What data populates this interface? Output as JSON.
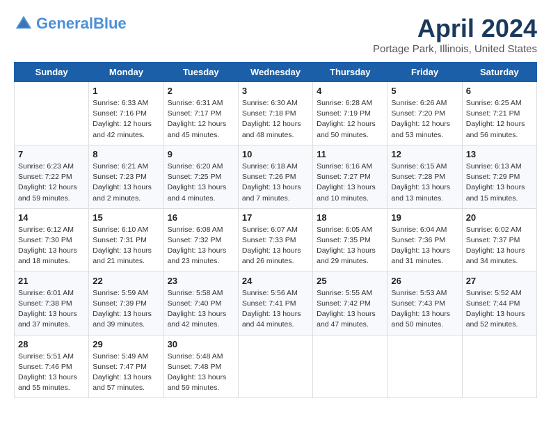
{
  "header": {
    "logo_line1": "General",
    "logo_line2": "Blue",
    "title": "April 2024",
    "subtitle": "Portage Park, Illinois, United States"
  },
  "weekdays": [
    "Sunday",
    "Monday",
    "Tuesday",
    "Wednesday",
    "Thursday",
    "Friday",
    "Saturday"
  ],
  "weeks": [
    [
      {
        "day": "",
        "info": ""
      },
      {
        "day": "1",
        "info": "Sunrise: 6:33 AM\nSunset: 7:16 PM\nDaylight: 12 hours\nand 42 minutes."
      },
      {
        "day": "2",
        "info": "Sunrise: 6:31 AM\nSunset: 7:17 PM\nDaylight: 12 hours\nand 45 minutes."
      },
      {
        "day": "3",
        "info": "Sunrise: 6:30 AM\nSunset: 7:18 PM\nDaylight: 12 hours\nand 48 minutes."
      },
      {
        "day": "4",
        "info": "Sunrise: 6:28 AM\nSunset: 7:19 PM\nDaylight: 12 hours\nand 50 minutes."
      },
      {
        "day": "5",
        "info": "Sunrise: 6:26 AM\nSunset: 7:20 PM\nDaylight: 12 hours\nand 53 minutes."
      },
      {
        "day": "6",
        "info": "Sunrise: 6:25 AM\nSunset: 7:21 PM\nDaylight: 12 hours\nand 56 minutes."
      }
    ],
    [
      {
        "day": "7",
        "info": "Sunrise: 6:23 AM\nSunset: 7:22 PM\nDaylight: 12 hours\nand 59 minutes."
      },
      {
        "day": "8",
        "info": "Sunrise: 6:21 AM\nSunset: 7:23 PM\nDaylight: 13 hours\nand 2 minutes."
      },
      {
        "day": "9",
        "info": "Sunrise: 6:20 AM\nSunset: 7:25 PM\nDaylight: 13 hours\nand 4 minutes."
      },
      {
        "day": "10",
        "info": "Sunrise: 6:18 AM\nSunset: 7:26 PM\nDaylight: 13 hours\nand 7 minutes."
      },
      {
        "day": "11",
        "info": "Sunrise: 6:16 AM\nSunset: 7:27 PM\nDaylight: 13 hours\nand 10 minutes."
      },
      {
        "day": "12",
        "info": "Sunrise: 6:15 AM\nSunset: 7:28 PM\nDaylight: 13 hours\nand 13 minutes."
      },
      {
        "day": "13",
        "info": "Sunrise: 6:13 AM\nSunset: 7:29 PM\nDaylight: 13 hours\nand 15 minutes."
      }
    ],
    [
      {
        "day": "14",
        "info": "Sunrise: 6:12 AM\nSunset: 7:30 PM\nDaylight: 13 hours\nand 18 minutes."
      },
      {
        "day": "15",
        "info": "Sunrise: 6:10 AM\nSunset: 7:31 PM\nDaylight: 13 hours\nand 21 minutes."
      },
      {
        "day": "16",
        "info": "Sunrise: 6:08 AM\nSunset: 7:32 PM\nDaylight: 13 hours\nand 23 minutes."
      },
      {
        "day": "17",
        "info": "Sunrise: 6:07 AM\nSunset: 7:33 PM\nDaylight: 13 hours\nand 26 minutes."
      },
      {
        "day": "18",
        "info": "Sunrise: 6:05 AM\nSunset: 7:35 PM\nDaylight: 13 hours\nand 29 minutes."
      },
      {
        "day": "19",
        "info": "Sunrise: 6:04 AM\nSunset: 7:36 PM\nDaylight: 13 hours\nand 31 minutes."
      },
      {
        "day": "20",
        "info": "Sunrise: 6:02 AM\nSunset: 7:37 PM\nDaylight: 13 hours\nand 34 minutes."
      }
    ],
    [
      {
        "day": "21",
        "info": "Sunrise: 6:01 AM\nSunset: 7:38 PM\nDaylight: 13 hours\nand 37 minutes."
      },
      {
        "day": "22",
        "info": "Sunrise: 5:59 AM\nSunset: 7:39 PM\nDaylight: 13 hours\nand 39 minutes."
      },
      {
        "day": "23",
        "info": "Sunrise: 5:58 AM\nSunset: 7:40 PM\nDaylight: 13 hours\nand 42 minutes."
      },
      {
        "day": "24",
        "info": "Sunrise: 5:56 AM\nSunset: 7:41 PM\nDaylight: 13 hours\nand 44 minutes."
      },
      {
        "day": "25",
        "info": "Sunrise: 5:55 AM\nSunset: 7:42 PM\nDaylight: 13 hours\nand 47 minutes."
      },
      {
        "day": "26",
        "info": "Sunrise: 5:53 AM\nSunset: 7:43 PM\nDaylight: 13 hours\nand 50 minutes."
      },
      {
        "day": "27",
        "info": "Sunrise: 5:52 AM\nSunset: 7:44 PM\nDaylight: 13 hours\nand 52 minutes."
      }
    ],
    [
      {
        "day": "28",
        "info": "Sunrise: 5:51 AM\nSunset: 7:46 PM\nDaylight: 13 hours\nand 55 minutes."
      },
      {
        "day": "29",
        "info": "Sunrise: 5:49 AM\nSunset: 7:47 PM\nDaylight: 13 hours\nand 57 minutes."
      },
      {
        "day": "30",
        "info": "Sunrise: 5:48 AM\nSunset: 7:48 PM\nDaylight: 13 hours\nand 59 minutes."
      },
      {
        "day": "",
        "info": ""
      },
      {
        "day": "",
        "info": ""
      },
      {
        "day": "",
        "info": ""
      },
      {
        "day": "",
        "info": ""
      }
    ]
  ]
}
